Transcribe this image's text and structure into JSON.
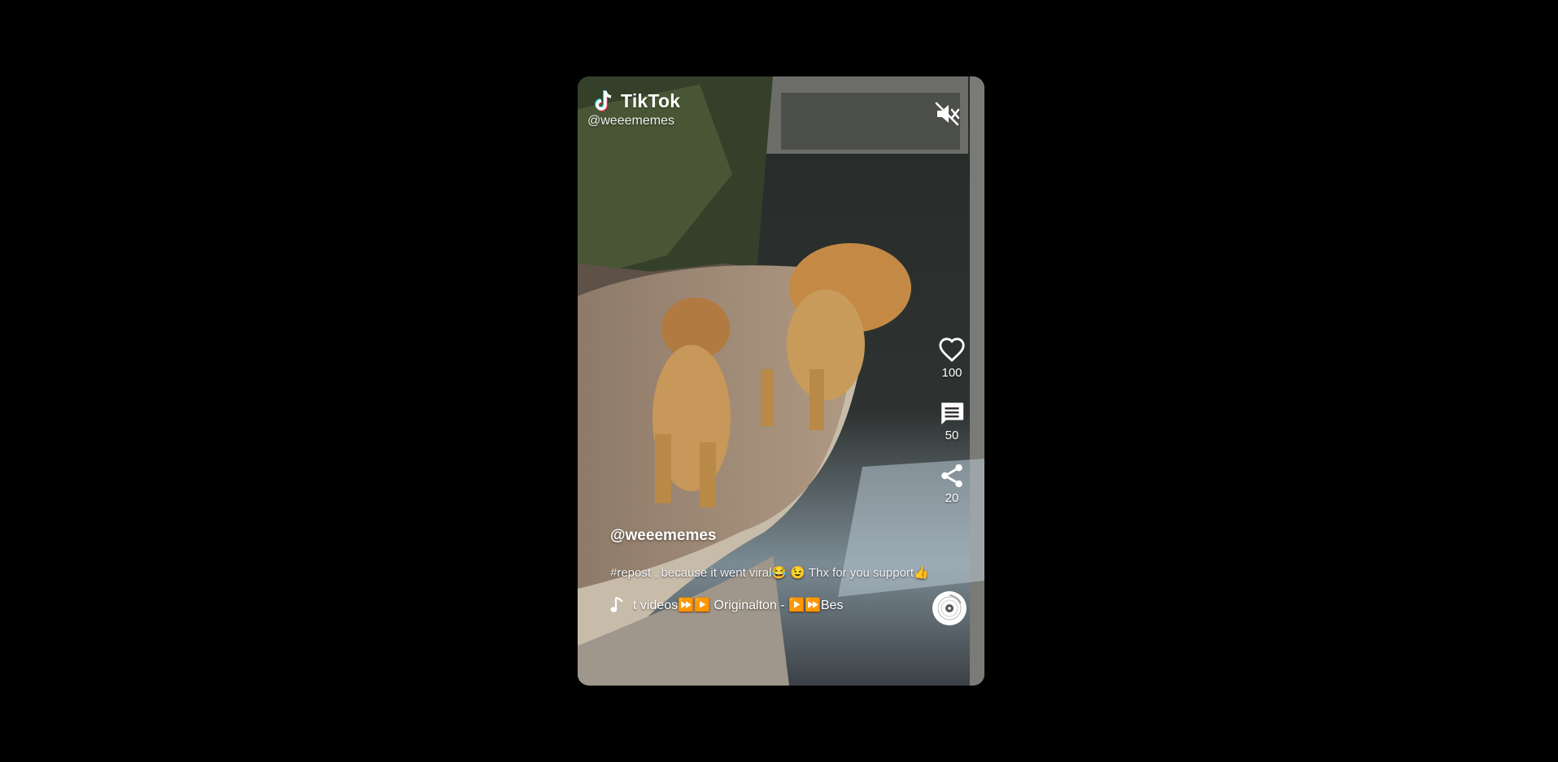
{
  "brand": {
    "name": "TikTok",
    "logo_icon": "tiktok-logo-icon"
  },
  "video": {
    "handle_overlay": "@weeememes",
    "muted": true,
    "mute_icon": "volume-muted-icon"
  },
  "actions": {
    "like": {
      "icon": "heart-icon",
      "count": "100"
    },
    "comment": {
      "icon": "comment-icon",
      "count": "50"
    },
    "share": {
      "icon": "share-icon",
      "count": "20"
    }
  },
  "post": {
    "author": "@weeememes",
    "caption": "#repost , because it went viral😂 😉 Thx for you support👍",
    "music_icon": "music-note-icon",
    "music_text": "t videos⏩▶️    Originalton - ▶️⏩Bes",
    "disc_icon": "music-disc-icon"
  },
  "colors": {
    "background": "#000000",
    "text": "#ffffff",
    "logo_cyan": "#25f4ee",
    "logo_pink": "#fe2c55"
  }
}
